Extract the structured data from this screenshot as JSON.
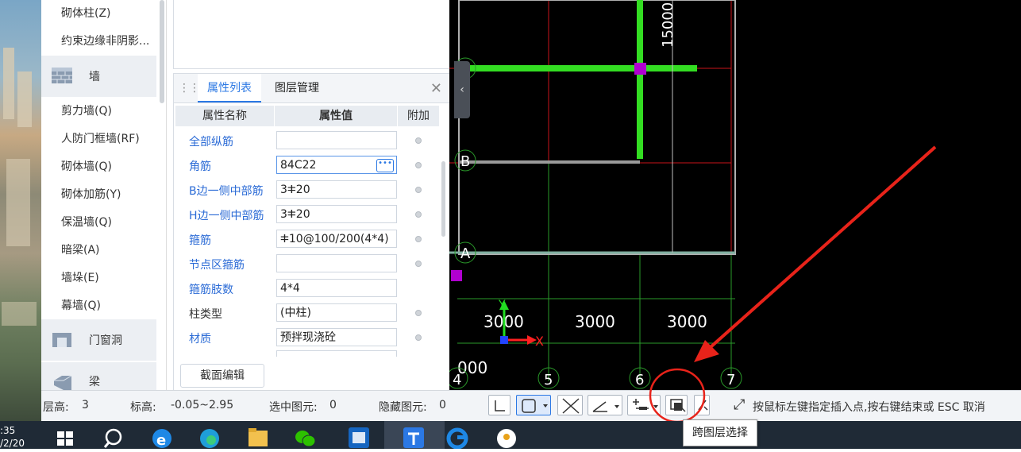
{
  "nav": {
    "items_top": [
      "砌体柱(Z)",
      "约束边缘非阴影..."
    ],
    "category_wall": "墙",
    "wall_items": [
      "剪力墙(Q)",
      "人防门框墙(RF)",
      "砌体墙(Q)",
      "砌体加筋(Y)",
      "保温墙(Q)",
      "暗梁(A)",
      "墙垛(E)",
      "幕墙(Q)"
    ],
    "category_opening": "门窗洞",
    "category_beam": "梁"
  },
  "panel": {
    "tabs": [
      "属性列表",
      "图层管理"
    ],
    "columns": [
      "属性名称",
      "属性值",
      "附加"
    ],
    "rows": [
      {
        "name": "全部纵筋",
        "value": ""
      },
      {
        "name": "角筋",
        "value": "84C22"
      },
      {
        "name": "B边一侧中部筋",
        "value": "3ⵐ20"
      },
      {
        "name": "H边一侧中部筋",
        "value": "3ⵐ20"
      },
      {
        "name": "箍筋",
        "value": "ⵐ10@100/200(4*4)"
      },
      {
        "name": "节点区箍筋",
        "value": ""
      },
      {
        "name": "箍筋肢数",
        "value": "4*4"
      },
      {
        "name": "柱类型",
        "value": "(中柱)"
      },
      {
        "name": "材质",
        "value": "预拌现浇砼"
      }
    ],
    "section_edit_label": "截面编辑"
  },
  "canvas": {
    "dim_vertical": "15000",
    "axis_labels": [
      "B",
      "A"
    ],
    "grid_numbers": [
      "4",
      "5",
      "6",
      "7"
    ],
    "spans": [
      "3000",
      "3000",
      "3000"
    ],
    "partial_span": "000",
    "axis_x": "X",
    "axis_y": "Y"
  },
  "status": {
    "floor_height_label": "层高:",
    "floor_height": "3",
    "elevation_label": "标高:",
    "elevation": "-0.05~2.95",
    "selected_label": "选中图元:",
    "selected": "0",
    "hidden_label": "隐藏图元:",
    "hidden": "0",
    "hint": "按鼠标左键指定插入点,按右键结束或 ESC 取消"
  },
  "tooltip": "跨图层选择",
  "taskbar": {
    "time": ":35",
    "date": "/2/20"
  },
  "colors": {
    "accent": "#2b78e4",
    "wall_green": "#33dd22",
    "annotation_red": "#e8231a",
    "column_magenta": "#b000d0"
  }
}
